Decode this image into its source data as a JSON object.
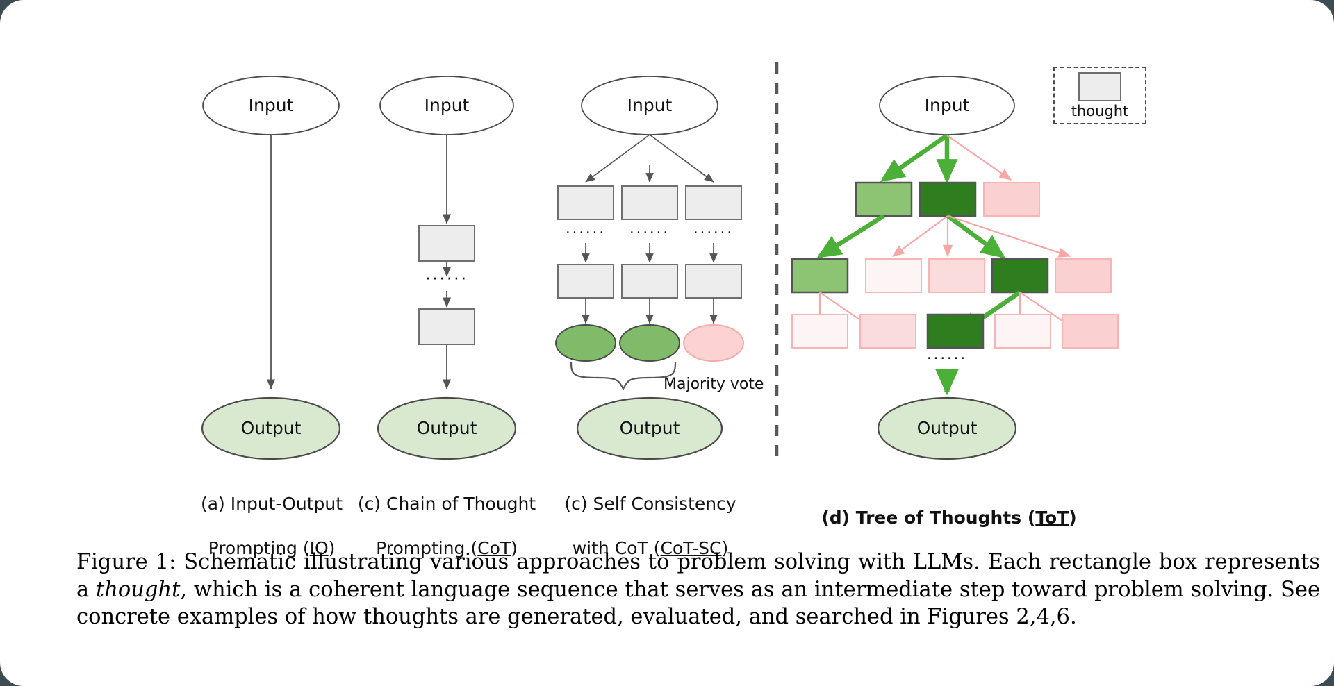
{
  "figure": {
    "node_labels": {
      "input": "Input",
      "output": "Output"
    },
    "legend": {
      "swatch_name": "thought-swatch",
      "label": "thought"
    },
    "majority_vote_label": "Majority vote",
    "ellipsis": "······",
    "colors": {
      "thought_gray_fill": "#ededed",
      "thought_gray_stroke": "#6e6e6e",
      "output_green_fill": "#d9e9d0",
      "output_green_stroke": "#4a4a4a",
      "vote_green_fill": "#80bb6a",
      "vote_pink_fill": "#fcd2d2",
      "vote_pink_stroke": "#f5a9a9",
      "tot_dark_green": "#2e7d1e",
      "tot_mid_green": "#8cc474",
      "tot_pink_strong": "#fbd0d0",
      "tot_pink_light": "#fdf0f0",
      "tot_pink_medium": "#fadcdc",
      "arrow_green": "#4caf38",
      "arrow_pink": "#f8a7a7",
      "arrow_gray": "#555555",
      "divider": "#585858"
    },
    "columns": [
      {
        "id": "io",
        "name": "input-output-prompting",
        "caption_lines": [
          "(a) Input-Output",
          "Prompting (IO)"
        ],
        "underlined": "IO",
        "bold": false
      },
      {
        "id": "cot",
        "name": "chain-of-thought-prompting",
        "caption_lines": [
          "(c) Chain of Thought",
          "Prompting (CoT)"
        ],
        "underlined": "CoT",
        "bold": false
      },
      {
        "id": "cot-sc",
        "name": "self-consistency-with-cot",
        "caption_lines": [
          "(c) Self Consistency",
          "with CoT (CoT-SC)"
        ],
        "underlined": "CoT-SC",
        "bold": false
      },
      {
        "id": "tot",
        "name": "tree-of-thoughts",
        "caption_lines": [
          "(d) Tree of Thoughts (ToT)"
        ],
        "underlined": "ToT",
        "bold": true
      }
    ]
  },
  "caption": {
    "prefix": "Figure 1: Schematic illustrating various approaches to problem solving with LLMs. Each rectangle box represents a ",
    "italic": "thought",
    "suffix": ", which is a coherent language sequence that serves as an intermediate step toward problem solving. See concrete examples of how thoughts are generated, evaluated, and searched in Figures 2,4,6."
  }
}
